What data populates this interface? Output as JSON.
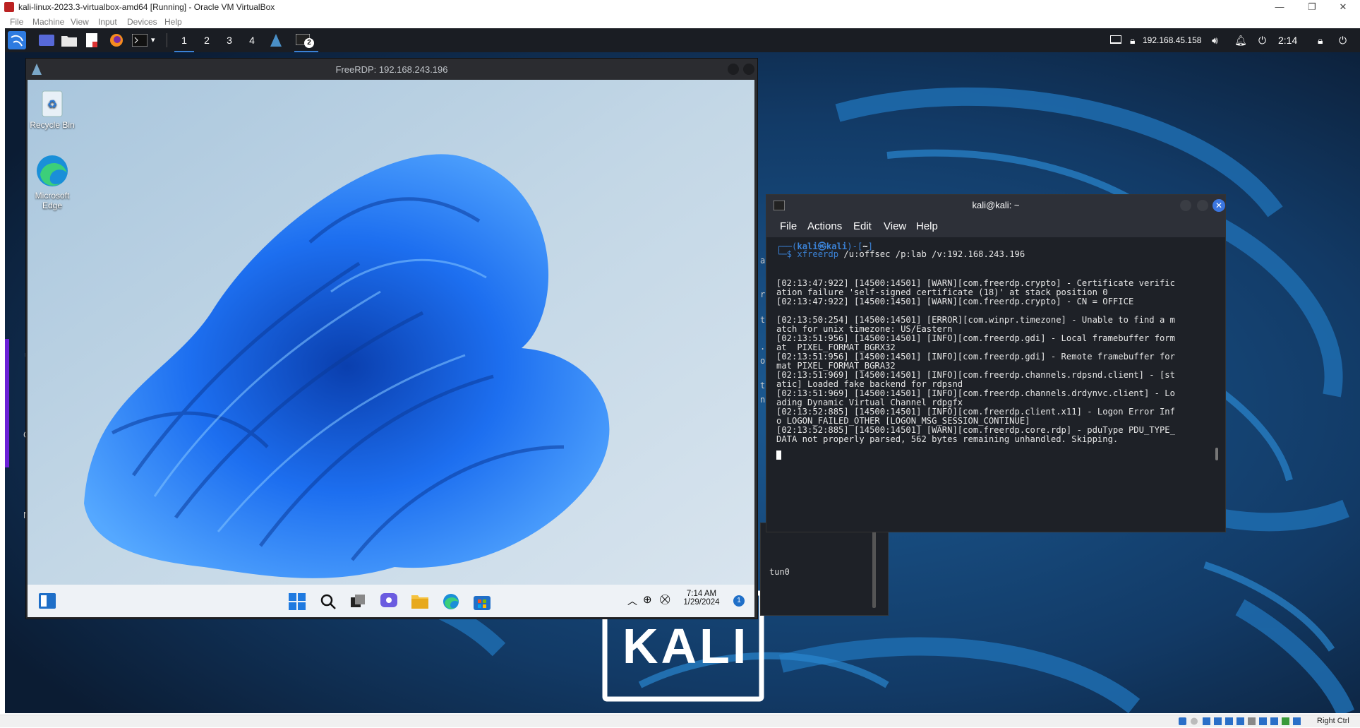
{
  "vbox": {
    "title": "kali-linux-2023.3-virtualbox-amd64 [Running] - Oracle VM VirtualBox",
    "menu": [
      "File",
      "Machine",
      "View",
      "Input",
      "Devices",
      "Help"
    ],
    "status_right": "Right Ctrl"
  },
  "panel": {
    "workspaces": [
      "1",
      "2",
      "3",
      "4"
    ],
    "terminal_badge": "2",
    "ip": "192.168.45.158",
    "clock": "2:14"
  },
  "rdp": {
    "title": "FreeRDP: 192.168.243.196",
    "desktop_icons": [
      {
        "label": "Recycle Bin",
        "icon": "recycle-bin-icon"
      },
      {
        "label": "Microsoft Edge",
        "icon": "edge-icon"
      }
    ],
    "taskbar": {
      "time": "7:14 AM",
      "date": "1/29/2024",
      "notification_count": "1"
    }
  },
  "terminal": {
    "title": "kali@kali: ~",
    "menu": [
      "File",
      "Actions",
      "Edit",
      "View",
      "Help"
    ],
    "prompt_user": "kali",
    "prompt_host": "kali",
    "prompt_dir": "~",
    "prompt_line1_pre": "┌──(",
    "prompt_line1_at": "㉿",
    "prompt_line1_mid": ")-[",
    "prompt_line1_post": "]",
    "prompt_line2": "└─$ ",
    "command": "xfreerdp",
    "command_args": " /u:offsec /p:lab /v:192.168.243.196",
    "output": [
      "[02:13:47:922] [14500:14501] [WARN][com.freerdp.crypto] - Certificate verific",
      "ation failure 'self-signed certificate (18)' at stack position 0",
      "[02:13:47:922] [14500:14501] [WARN][com.freerdp.crypto] - CN = OFFICE",
      "",
      "[02:13:50:254] [14500:14501] [ERROR][com.winpr.timezone] - Unable to find a m",
      "atch for unix timezone: US/Eastern",
      "[02:13:51:956] [14500:14501] [INFO][com.freerdp.gdi] - Local framebuffer form",
      "at  PIXEL_FORMAT_BGRX32",
      "[02:13:51:956] [14500:14501] [INFO][com.freerdp.gdi] - Remote framebuffer for",
      "mat PIXEL_FORMAT_BGRA32",
      "[02:13:51:969] [14500:14501] [INFO][com.freerdp.channels.rdpsnd.client] - [st",
      "atic] Loaded fake backend for rdpsnd",
      "[02:13:51:969] [14500:14501] [INFO][com.freerdp.channels.drdynvc.client] - Lo",
      "ading Dynamic Virtual Channel rdpgfx",
      "[02:13:52:885] [14500:14501] [INFO][com.freerdp.client.x11] - Logon Error Inf",
      "o LOGON_FAILED_OTHER [LOGON_MSG_SESSION_CONTINUE]",
      "[02:13:52:885] [14500:14501] [WARN][com.freerdp.core.rdp] - pduType PDU_TYPE_",
      "DATA not properly parsed, 562 bytes remaining unhandled. Skipping."
    ]
  },
  "back_window": {
    "text": "tun0",
    "side_letters": [
      "a",
      "r",
      "t",
      ".",
      "o",
      "t",
      "n"
    ]
  },
  "left_edge_letters": [
    "u",
    "C",
    "N"
  ],
  "wallpaper_brand": "KALI",
  "colors": {
    "kali_blue": "#3b82d6",
    "terminal_bg": "#1e2127",
    "panel_bg": "#1a1d23",
    "close_button": "#3b76e0"
  }
}
